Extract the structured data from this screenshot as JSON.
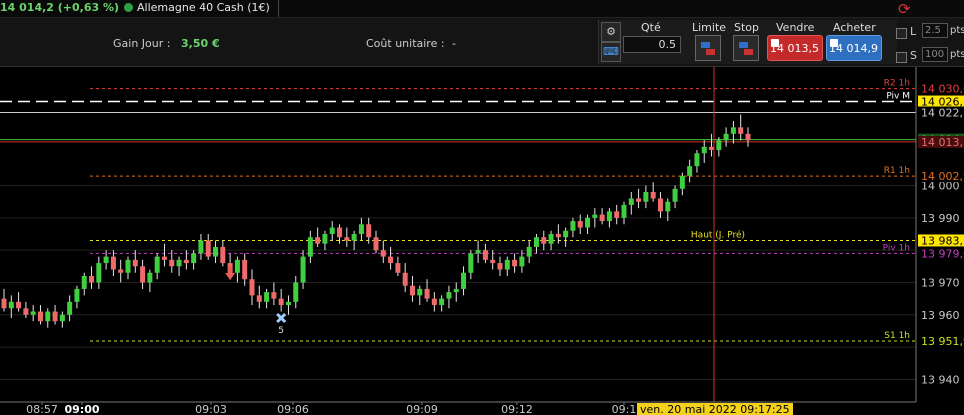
{
  "header": {
    "price_change": "14 014,2 (+0,63 %)",
    "instrument": "Allemagne 40 Cash (1€)"
  },
  "panel": {
    "gain_label": "Gain Jour :",
    "gain_value": "3,50 €",
    "cout_label": "Coût unitaire :",
    "cout_value": "-",
    "qty_label": "Qté",
    "qty_value": "0.5",
    "limit_label": "Limite",
    "stop_label": "Stop",
    "sell_label": "Vendre",
    "buy_label": "Acheter",
    "sell_price": "14 013,5",
    "buy_price": "14 014,9",
    "opt_l_label": "L",
    "opt_s_label": "S",
    "opt_l_value": "2.5",
    "opt_s_value": "100",
    "pts_label": "pts"
  },
  "chart_data": {
    "type": "candlestick",
    "instrument": "Allemagne 40 Cash (1€)",
    "y_range": [
      13933,
      14037
    ],
    "y_ticks": [
      "14 000",
      "13 990",
      "13 970",
      "13 960",
      "13 940"
    ],
    "x_ticks": [
      "08:57",
      "09:00",
      "09:03",
      "09:06",
      "09:09",
      "09:12",
      "09:1"
    ],
    "crosshair_time": "ven. 20 mai 2022 09:17:25",
    "levels": [
      {
        "name": "R2 1h",
        "value": 14030.0,
        "label": "14 030,0",
        "color": "#e04040"
      },
      {
        "name": "Piv M",
        "value": 14026.0,
        "label": "14 026,",
        "color": "#ffffff"
      },
      {
        "name": "",
        "value": 14022.6,
        "label": "14 022,",
        "color": "#cccccc"
      },
      {
        "name": "",
        "value": 14014.2,
        "label": "14 014,",
        "color": "#3bc43b"
      },
      {
        "name": "",
        "value": 14013.5,
        "label": "14 013,",
        "color": "#d03030"
      },
      {
        "name": "R1 1h",
        "value": 14002.9,
        "label": "14 002,9",
        "color": "#e07020"
      },
      {
        "name": "Haut (J. Pré)",
        "value": 13983.0,
        "label": "13 983,",
        "color": "#e8e020"
      },
      {
        "name": "Piv 1h",
        "value": 13979.0,
        "label": "13 979,0",
        "color": "#c040c0"
      },
      {
        "name": "S1 1h",
        "value": 13951.9,
        "label": "13 951,9",
        "color": "#c8e020"
      }
    ],
    "candles": [
      [
        13965,
        13968,
        13961,
        13962
      ],
      [
        13962,
        13966,
        13959,
        13964
      ],
      [
        13964,
        13967,
        13961,
        13962
      ],
      [
        13962,
        13964,
        13959,
        13960
      ],
      [
        13960,
        13963,
        13958,
        13961
      ],
      [
        13961,
        13963,
        13957,
        13958
      ],
      [
        13958,
        13962,
        13956,
        13961
      ],
      [
        13961,
        13963,
        13957,
        13958
      ],
      [
        13958,
        13961,
        13956,
        13960
      ],
      [
        13960,
        13966,
        13958,
        13964
      ],
      [
        13964,
        13969,
        13962,
        13968
      ],
      [
        13968,
        13973,
        13966,
        13972
      ],
      [
        13972,
        13975,
        13968,
        13970
      ],
      [
        13970,
        13978,
        13968,
        13976
      ],
      [
        13976,
        13980,
        13974,
        13978
      ],
      [
        13978,
        13980,
        13972,
        13974
      ],
      [
        13974,
        13977,
        13970,
        13973
      ],
      [
        13973,
        13978,
        13971,
        13977
      ],
      [
        13977,
        13980,
        13973,
        13975
      ],
      [
        13975,
        13977,
        13968,
        13970
      ],
      [
        13970,
        13974,
        13967,
        13973
      ],
      [
        13973,
        13979,
        13971,
        13978
      ],
      [
        13978,
        13982,
        13975,
        13977
      ],
      [
        13977,
        13980,
        13973,
        13975
      ],
      [
        13975,
        13978,
        13972,
        13977
      ],
      [
        13977,
        13980,
        13974,
        13976
      ],
      [
        13976,
        13980,
        13974,
        13979
      ],
      [
        13979,
        13985,
        13977,
        13983
      ],
      [
        13983,
        13985,
        13977,
        13978
      ],
      [
        13978,
        13983,
        13976,
        13981
      ],
      [
        13981,
        13983,
        13975,
        13976
      ],
      [
        13976,
        13979,
        13971,
        13973
      ],
      [
        13973,
        13978,
        13970,
        13977
      ],
      [
        13977,
        13979,
        13969,
        13971
      ],
      [
        13971,
        13974,
        13963,
        13966
      ],
      [
        13966,
        13969,
        13962,
        13964
      ],
      [
        13964,
        13968,
        13962,
        13967
      ],
      [
        13967,
        13970,
        13963,
        13965
      ],
      [
        13965,
        13968,
        13961,
        13963
      ],
      [
        13963,
        13966,
        13960,
        13964
      ],
      [
        13964,
        13972,
        13962,
        13970
      ],
      [
        13970,
        13980,
        13968,
        13978
      ],
      [
        13978,
        13986,
        13976,
        13984
      ],
      [
        13984,
        13987,
        13981,
        13982
      ],
      [
        13982,
        13986,
        13980,
        13985
      ],
      [
        13985,
        13989,
        13983,
        13987
      ],
      [
        13987,
        13988,
        13982,
        13984
      ],
      [
        13984,
        13987,
        13981,
        13983
      ],
      [
        13983,
        13986,
        13980,
        13985
      ],
      [
        13985,
        13990,
        13983,
        13988
      ],
      [
        13988,
        13990,
        13982,
        13984
      ],
      [
        13984,
        13986,
        13979,
        13980
      ],
      [
        13980,
        13983,
        13976,
        13978
      ],
      [
        13978,
        13981,
        13974,
        13976
      ],
      [
        13976,
        13978,
        13972,
        13973
      ],
      [
        13973,
        13976,
        13967,
        13969
      ],
      [
        13969,
        13972,
        13964,
        13966
      ],
      [
        13966,
        13969,
        13963,
        13968
      ],
      [
        13968,
        13971,
        13964,
        13965
      ],
      [
        13965,
        13967,
        13961,
        13963
      ],
      [
        13963,
        13966,
        13961,
        13965
      ],
      [
        13965,
        13969,
        13962,
        13967
      ],
      [
        13967,
        13970,
        13964,
        13968
      ],
      [
        13968,
        13975,
        13966,
        13973
      ],
      [
        13973,
        13980,
        13971,
        13979
      ],
      [
        13979,
        13983,
        13976,
        13980
      ],
      [
        13980,
        13982,
        13976,
        13977
      ],
      [
        13977,
        13980,
        13974,
        13976
      ],
      [
        13976,
        13978,
        13972,
        13974
      ],
      [
        13974,
        13978,
        13972,
        13977
      ],
      [
        13977,
        13979,
        13973,
        13975
      ],
      [
        13975,
        13980,
        13973,
        13978
      ],
      [
        13978,
        13983,
        13976,
        13981
      ],
      [
        13981,
        13985,
        13979,
        13984
      ],
      [
        13984,
        13986,
        13980,
        13982
      ],
      [
        13982,
        13986,
        13980,
        13985
      ],
      [
        13985,
        13988,
        13982,
        13984
      ],
      [
        13984,
        13987,
        13981,
        13986
      ],
      [
        13986,
        13990,
        13984,
        13989
      ],
      [
        13989,
        13991,
        13985,
        13987
      ],
      [
        13987,
        13991,
        13985,
        13990
      ],
      [
        13990,
        13993,
        13987,
        13991
      ],
      [
        13991,
        13993,
        13988,
        13989
      ],
      [
        13989,
        13993,
        13987,
        13992
      ],
      [
        13992,
        13994,
        13988,
        13990
      ],
      [
        13990,
        13995,
        13988,
        13994
      ],
      [
        13994,
        13998,
        13991,
        13996
      ],
      [
        13996,
        13999,
        13993,
        13995
      ],
      [
        13995,
        14000,
        13993,
        13998
      ],
      [
        13998,
        14001,
        13995,
        13996
      ],
      [
        13996,
        13998,
        13990,
        13992
      ],
      [
        13992,
        13996,
        13989,
        13995
      ],
      [
        13995,
        14000,
        13993,
        13999
      ],
      [
        13999,
        14004,
        13997,
        14003
      ],
      [
        14003,
        14008,
        14001,
        14006
      ],
      [
        14006,
        14011,
        14004,
        14010
      ],
      [
        14010,
        14014,
        14007,
        14012
      ],
      [
        14012,
        14016,
        14009,
        14011
      ],
      [
        14011,
        14015,
        14009,
        14014
      ],
      [
        14014,
        14018,
        14012,
        14016
      ],
      [
        14016,
        14020,
        14013,
        14018
      ],
      [
        14018,
        14022,
        14014,
        14016
      ],
      [
        14016,
        14018,
        14012,
        14014
      ]
    ],
    "markers": [
      {
        "type": "arrow-down",
        "index": 31
      },
      {
        "type": "cross",
        "index": 38,
        "label": "5"
      }
    ]
  }
}
